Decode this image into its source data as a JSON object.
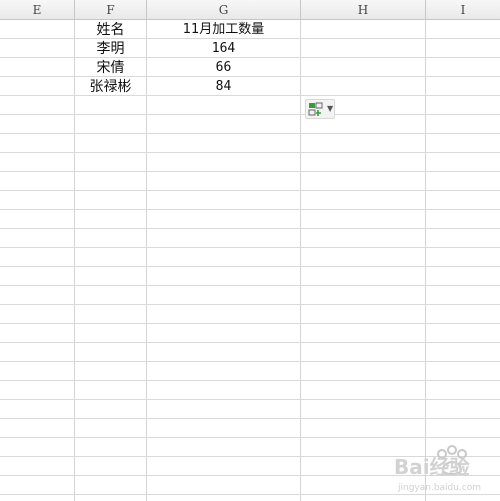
{
  "spreadsheet": {
    "columns": [
      "E",
      "F",
      "G",
      "H",
      "I"
    ],
    "rows": [
      {
        "name": "姓名",
        "value": "11月加工数量"
      },
      {
        "name": "李明",
        "value": "164"
      },
      {
        "name": "宋倩",
        "value": "66"
      },
      {
        "name": "张禄彬",
        "value": "84"
      }
    ]
  },
  "paste_options": {
    "icon": "paste-options-icon",
    "dropdown_icon": "triangle-down-icon"
  },
  "watermark": {
    "text": "Bai经验",
    "url_text": "jingyan.baidu.com"
  },
  "colors": {
    "header_bg": "#ececec",
    "grid_line": "#d9d9d9",
    "paste_icon_green": "#3c9a3c"
  }
}
